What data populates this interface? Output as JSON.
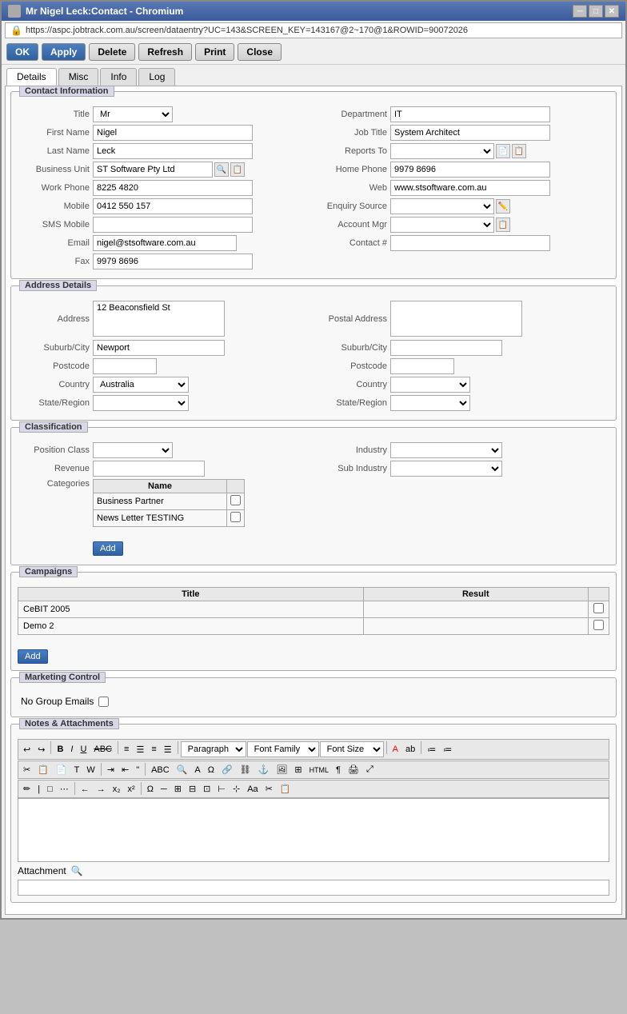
{
  "window": {
    "title": "Mr Nigel Leck:Contact - Chromium",
    "url": "https://aspc.jobtrack.com.au/screen/dataentry?UC=143&SCREEN_KEY=143167@2~170@1&ROWID=90072026"
  },
  "toolbar": {
    "ok": "OK",
    "apply": "Apply",
    "delete": "Delete",
    "refresh": "Refresh",
    "print": "Print",
    "close": "Close"
  },
  "tabs": {
    "details": "Details",
    "misc": "Misc",
    "info": "Info",
    "log": "Log"
  },
  "contact_information": {
    "section_title": "Contact Information",
    "title_label": "Title",
    "title_value": "Mr",
    "first_name_label": "First Name",
    "first_name_value": "Nigel",
    "last_name_label": "Last Name",
    "last_name_value": "Leck",
    "business_unit_label": "Business Unit",
    "business_unit_value": "ST Software Pty Ltd",
    "work_phone_label": "Work Phone",
    "work_phone_value": "8225 4820",
    "mobile_label": "Mobile",
    "mobile_value": "0412 550 157",
    "sms_mobile_label": "SMS Mobile",
    "sms_mobile_value": "",
    "email_label": "Email",
    "email_value": "nigel@stsoftware.com.au",
    "fax_label": "Fax",
    "fax_value": "9979 8696",
    "department_label": "Department",
    "department_value": "IT",
    "job_title_label": "Job Title",
    "job_title_value": "System Architect",
    "reports_to_label": "Reports To",
    "reports_to_value": "",
    "home_phone_label": "Home Phone",
    "home_phone_value": "9979 8696",
    "web_label": "Web",
    "web_value": "www.stsoftware.com.au",
    "enquiry_source_label": "Enquiry Source",
    "enquiry_source_value": "",
    "account_mgr_label": "Account Mgr",
    "account_mgr_value": "",
    "contact_hash_label": "Contact #",
    "contact_hash_value": ""
  },
  "address_details": {
    "section_title": "Address Details",
    "address_label": "Address",
    "address_value": "12 Beaconsfield St",
    "suburb_city_label": "Suburb/City",
    "suburb_city_value": "Newport",
    "postcode_label": "Postcode",
    "postcode_value": "",
    "country_label": "Country",
    "country_value": "Australia",
    "state_region_label": "State/Region",
    "state_region_value": "",
    "postal_address_label": "Postal Address",
    "postal_address_value": "",
    "suburb_city2_label": "Suburb/City",
    "suburb_city2_value": "",
    "postcode2_label": "Postcode",
    "postcode2_value": "",
    "country2_label": "Country",
    "country2_value": "",
    "state_region2_label": "State/Region",
    "state_region2_value": ""
  },
  "classification": {
    "section_title": "Classification",
    "position_class_label": "Position Class",
    "position_class_value": "",
    "revenue_label": "Revenue",
    "revenue_value": "",
    "categories_label": "Categories",
    "categories_col_name": "Name",
    "categories": [
      {
        "name": "Business Partner",
        "checked": false
      },
      {
        "name": "News Letter TESTING",
        "checked": false
      }
    ],
    "add_btn": "Add",
    "industry_label": "Industry",
    "industry_value": "",
    "sub_industry_label": "Sub Industry",
    "sub_industry_value": ""
  },
  "campaigns": {
    "section_title": "Campaigns",
    "col_title": "Title",
    "col_result": "Result",
    "rows": [
      {
        "title": "CeBIT 2005",
        "result": "",
        "checked": false
      },
      {
        "title": "Demo 2",
        "result": "",
        "checked": false
      }
    ],
    "add_btn": "Add"
  },
  "marketing_control": {
    "section_title": "Marketing Control",
    "no_group_emails_label": "No Group Emails",
    "no_group_emails_checked": false
  },
  "notes_attachments": {
    "section_title": "Notes & Attachments",
    "paragraph_options": [
      "Paragraph"
    ],
    "font_family_label": "Font Family",
    "font_size_label": "Font Size",
    "attachment_label": "Attachment"
  }
}
